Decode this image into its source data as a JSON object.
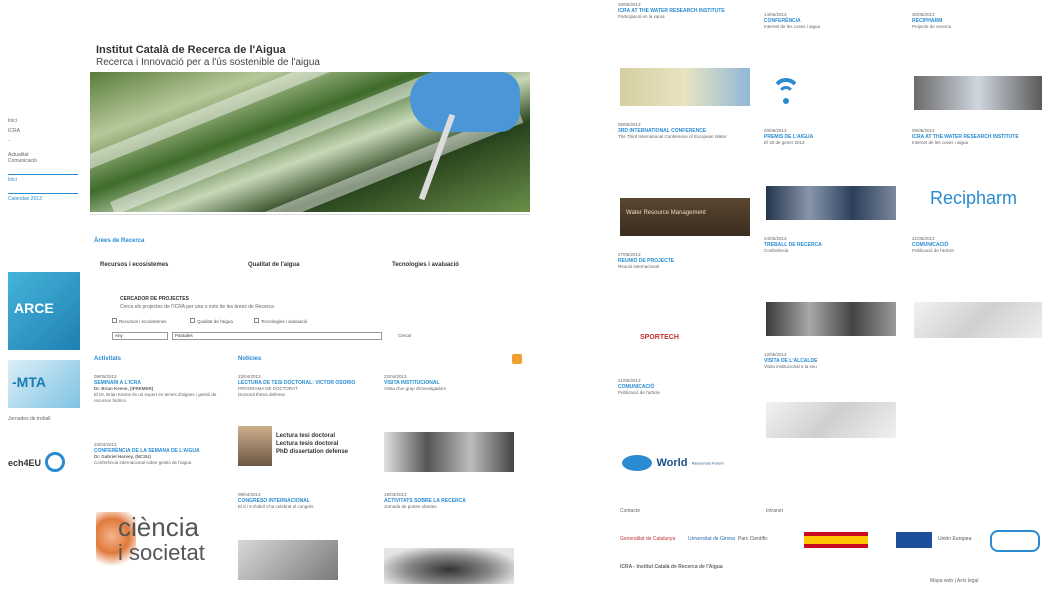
{
  "header": {
    "title": "Institut Català de Recerca de l'Aigua",
    "subtitle": "Recerca i Innovació per a l'ús sostenible de l'aigua"
  },
  "areas": {
    "heading": "Àrees de Recerca",
    "tabs": [
      "Recursos i ecosistemes",
      "Qualitat de l'aigua",
      "Tecnologies i avaluació"
    ]
  },
  "projects": {
    "title": "CERCADOR DE PROJECTES",
    "desc": "Cerca els projectes de l'ICRA per una o més de les àrees de Recerca",
    "checks": [
      "Recursos i ecosistemes",
      "Qualitat de l'aigua",
      "Tecnologies i avaluació"
    ],
    "select_value": "Any",
    "input_value": "Paraules",
    "search_label": "Cercar"
  },
  "sections": {
    "activities": "Activitats",
    "news": "Notícies"
  },
  "sidebar": {
    "items": [
      "Inici",
      "ICRA",
      "",
      "Actualitat",
      "Comunicació"
    ],
    "active": "Inici",
    "sub": "Calendari 2013"
  },
  "left_news": [
    {
      "date": "09/05/2013",
      "title": "SEMINARI A L'ICRA",
      "sub": "Dr. Brian Keene, (IFREMER)",
      "text": "El Dr. Brian Keene és un expert en temes d'aigües i gestió de recursos hídrics"
    },
    {
      "date": "22/04/2013",
      "title": "CONFERÈNCIA DE LA SEMANA DE L'AIGUA",
      "sub": "Dr. Gabriel Harvey, (NCSU)",
      "text": "Conferència internacional sobre gestió de l'aigua"
    },
    {
      "date": "23/04/2013",
      "title": "LECTURA DE TESI DOCTORAL: VICTOR OSORIO",
      "sub": "PROGRAMA DE DOCTORAT",
      "text": "Doctoral thesis defense"
    },
    {
      "date": "22/04/2013",
      "title": "VISITA INSTITUCIONAL",
      "sub": "",
      "text": "Visita d'un grup d'investigadors"
    },
    {
      "date": "08/04/2013",
      "title": "CONGRESO INTERNACIONAL",
      "sub": "",
      "text": "El 8 i 9 d'abril s'ha celebrat el congrés"
    },
    {
      "date": "19/03/2013",
      "title": "ACTIVITATS SOBRE LA RECERCA",
      "sub": "",
      "text": "Jornada de portes obertes"
    }
  ],
  "thesis_caption": [
    "Lectura tesi doctoral",
    "Lectura tesis doctoral",
    "PhD dissertation defense"
  ],
  "ciencia": {
    "line1": "ciència",
    "line2": "i societat"
  },
  "right_news": [
    {
      "date": "25/06/2013",
      "title": "ICRA AT THE WATER RESEARCH INSTITUTE",
      "text": "Participació en la xarxa"
    },
    {
      "date": "14/06/2013",
      "title": "CONFERÈNCIA",
      "text": "Internet de les coses i aigua"
    },
    {
      "date": "12/06/2013",
      "title": "VISITA DE L'ALCALDE",
      "text": "Visita institucional a la seu"
    },
    {
      "date": "05/06/2013",
      "title": "3RD INTERNATIONAL CONFERENCE",
      "text": "The Third International Conference of European Water"
    },
    {
      "date": "03/06/2013",
      "title": "PREMIS DE L'AIGUA",
      "text": "El 30 de gener 2013"
    },
    {
      "date": "30/05/2013",
      "title": "RECIPHARM",
      "text": "Projecte de recerca"
    },
    {
      "date": "27/05/2013",
      "title": "REUNIÓ DE PROJECTE",
      "text": "Reunió internacional"
    },
    {
      "date": "24/05/2013",
      "title": "TREBALL DE RECERCA",
      "text": "Conferència"
    },
    {
      "date": "21/05/2013",
      "title": "COMUNICACIÓ",
      "text": "Publicació de l'article"
    }
  ],
  "world": {
    "big": "World",
    "small": "Resources Forum"
  },
  "recipharm": "Recipharm",
  "footer": {
    "links": [
      "Contacte",
      "Intranet",
      "Mapa web",
      "Avís legal"
    ],
    "address": "ICRA - Institut Català de Recerca de l'Aigua",
    "sponsors": [
      "Generalitat de Catalunya",
      "Universitat de Girona",
      "Parc Científic",
      "Gobierno de España",
      "Unión Europea",
      "CERCA"
    ]
  }
}
